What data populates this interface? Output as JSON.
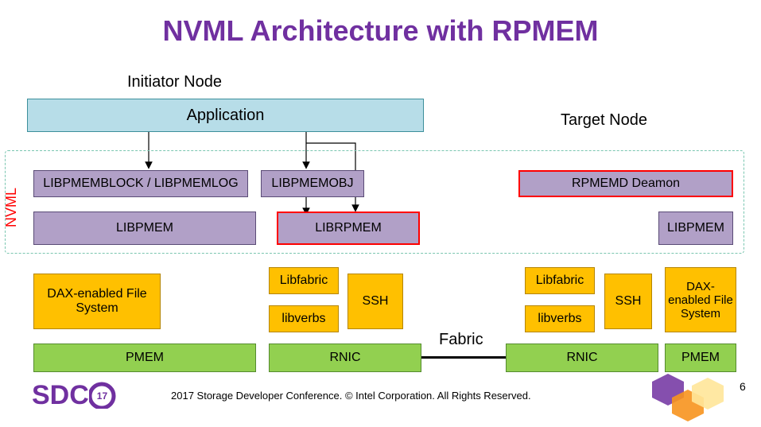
{
  "title": "NVML Architecture with RPMEM",
  "sections": {
    "initiator": "Initiator Node",
    "target": "Target Node"
  },
  "nvml_label": "NVML",
  "boxes": {
    "application": "Application",
    "libpmemblock": "LIBPMEMBLOCK / LIBPMEMLOG",
    "libpmemobj": "LIBPMEMOBJ",
    "libpmem_left": "LIBPMEM",
    "librpmem": "LIBRPMEM",
    "rpmemd": "RPMEMD Deamon",
    "libpmem_right": "LIBPMEM",
    "dax_left": "DAX-enabled File System",
    "libfabric_left": "Libfabric",
    "libverbs_left": "libverbs",
    "ssh_left": "SSH",
    "libfabric_right": "Libfabric",
    "libverbs_right": "libverbs",
    "ssh_right": "SSH",
    "dax_right": "DAX-enabled File System",
    "pmem_left": "PMEM",
    "rnic_left": "RNIC",
    "rnic_right": "RNIC",
    "pmem_right": "PMEM"
  },
  "fabric_label": "Fabric",
  "footer": "2017 Storage  Developer Conference. © Intel Corporation.  All Rights Reserved.",
  "page_number": "6",
  "logo": {
    "text": "SDC",
    "badge": "17"
  }
}
